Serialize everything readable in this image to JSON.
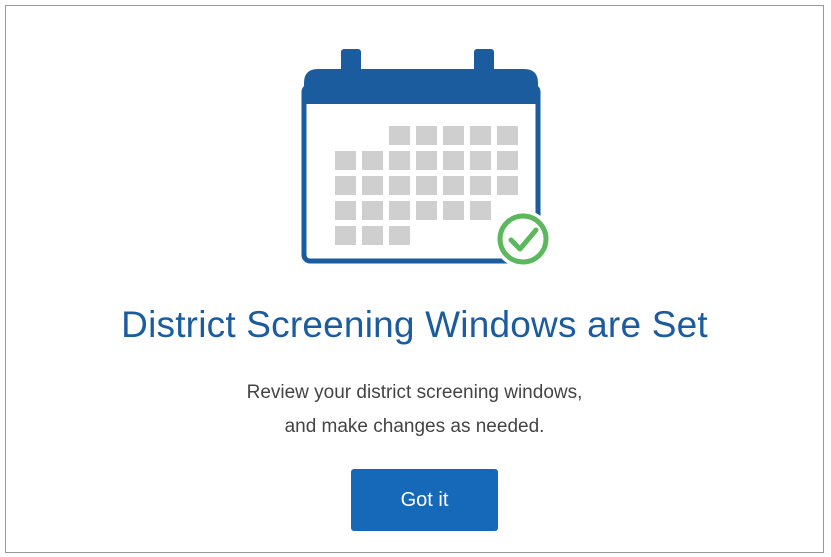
{
  "dialog": {
    "title": "District Screening Windows are Set",
    "message_lines": [
      "Review your district screening windows,",
      "and make changes as needed."
    ],
    "confirm_label": "Got it"
  },
  "icons": {
    "illustration": "calendar-check-icon"
  },
  "colors": {
    "title": "#1a5c9e",
    "button": "#1668b8",
    "calendar_frame": "#1a5c9e",
    "calendar_cells": "#cfcfcf",
    "check": "#5cb85c"
  }
}
